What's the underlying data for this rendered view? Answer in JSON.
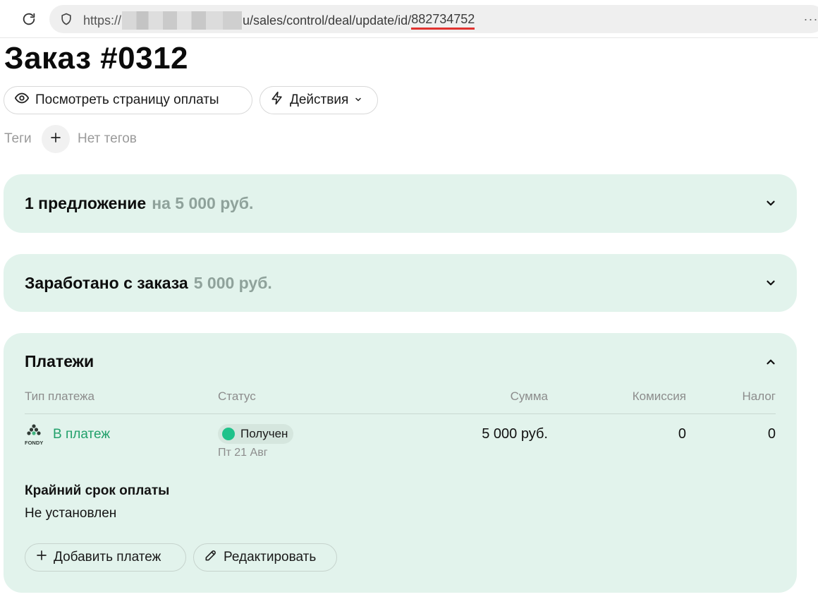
{
  "browser": {
    "url_prefix": "https://",
    "url_path": "u/sales/control/deal/update/id/",
    "url_id": "882734752",
    "menu_dots": "···"
  },
  "page": {
    "title": "Заказ #0312"
  },
  "toolbar": {
    "preview_label": "Посмотреть страницу оплаты",
    "actions_label": "Действия"
  },
  "tags": {
    "label": "Теги",
    "empty_text": "Нет тегов"
  },
  "offer_card": {
    "title": "1 предложение",
    "amount": "на 5 000 руб."
  },
  "earned_card": {
    "title": "Заработано с заказа",
    "amount": "5 000 руб."
  },
  "payments": {
    "title": "Платежи",
    "columns": {
      "type": "Тип платежа",
      "status": "Статус",
      "sum": "Сумма",
      "fee": "Комиссия",
      "tax": "Налог"
    },
    "rows": [
      {
        "provider_logo_text": "FONDY",
        "link_label": "В платеж",
        "status": "Получен",
        "status_date": "Пт 21 Авг",
        "sum": "5 000 руб.",
        "fee": "0",
        "tax": "0"
      }
    ],
    "deadline_label": "Крайний срок оплаты",
    "deadline_value": "Не установлен",
    "add_label": "Добавить платеж",
    "edit_label": "Редактировать"
  },
  "colors": {
    "card_bg": "#e2f3ec",
    "accent_green": "#22a06b",
    "status_dot": "#1fc28a",
    "url_underline": "#e0322f"
  },
  "icons": [
    "reload-icon",
    "shield-icon",
    "eye-icon",
    "lightning-icon",
    "chevron-down-icon",
    "plus-icon",
    "chevron-up-icon",
    "fondy-logo",
    "pencil-icon"
  ]
}
